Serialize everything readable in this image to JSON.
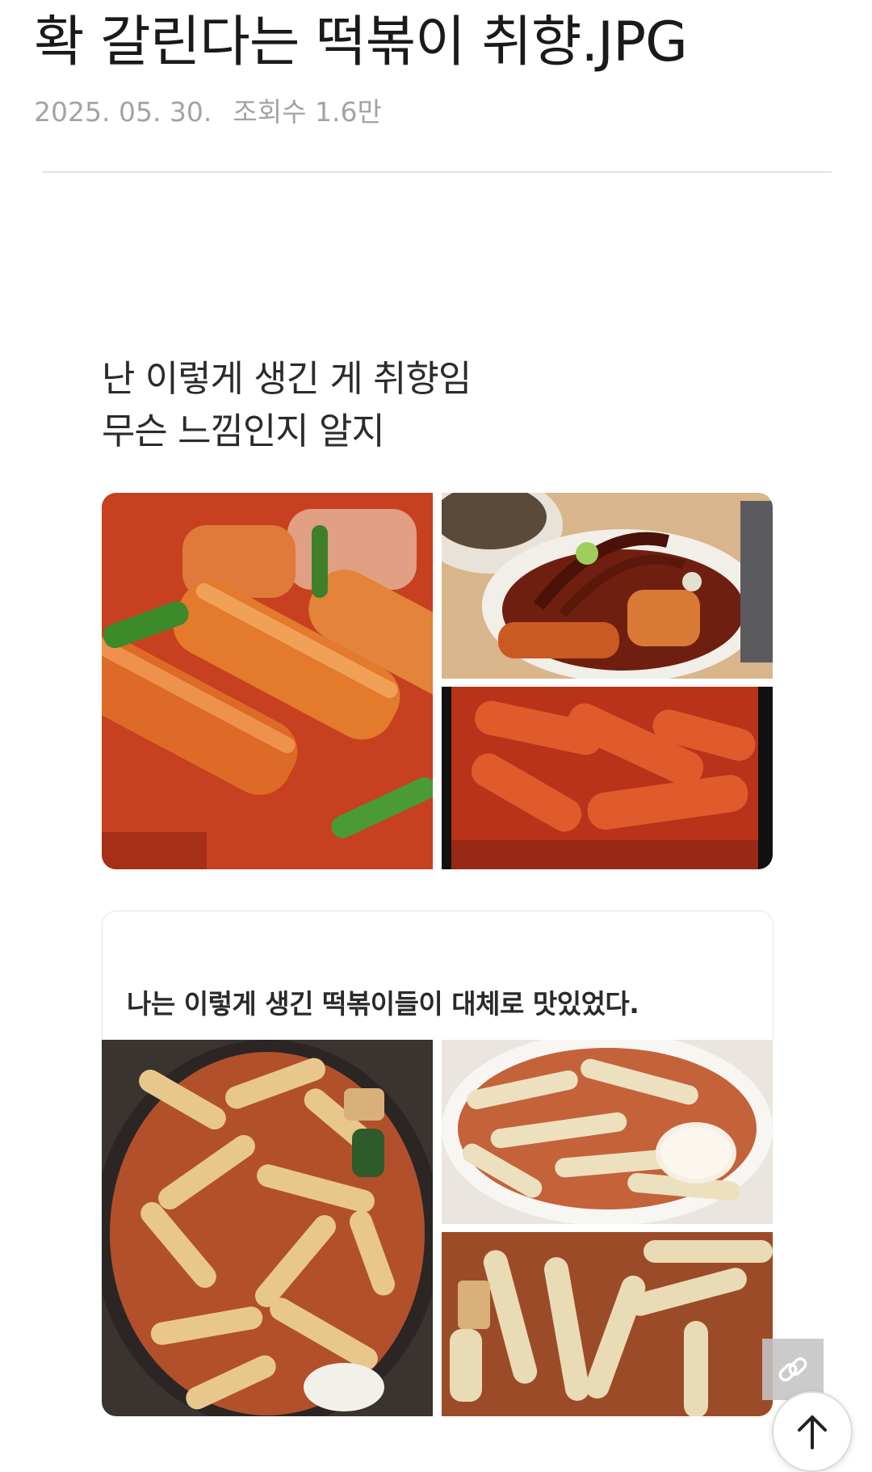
{
  "post": {
    "title": "확 갈린다는 떡볶이 취향.JPG",
    "date": "2025. 05. 30.",
    "views": "조회수 1.6만"
  },
  "content": {
    "caption_line1": "난 이렇게 생긴 게 취향임",
    "caption_line2": "무슨 느낌인지 알지",
    "card_text": "나는 이렇게 생긴 떡볶이들이 대체로 맛있었다."
  },
  "images": [
    {
      "name": "photo-thick-rice-cakes-closeup"
    },
    {
      "name": "photo-glossy-rice-cakes-plate"
    },
    {
      "name": "photo-red-rice-cakes-plate"
    },
    {
      "name": "photo-thin-rice-cakes-pan"
    },
    {
      "name": "photo-thin-rice-cakes-bowl-egg"
    },
    {
      "name": "photo-thin-rice-cakes-soup"
    }
  ],
  "actions": {
    "copy_link_icon": "link-icon",
    "scroll_top_icon": "arrow-up-icon"
  }
}
